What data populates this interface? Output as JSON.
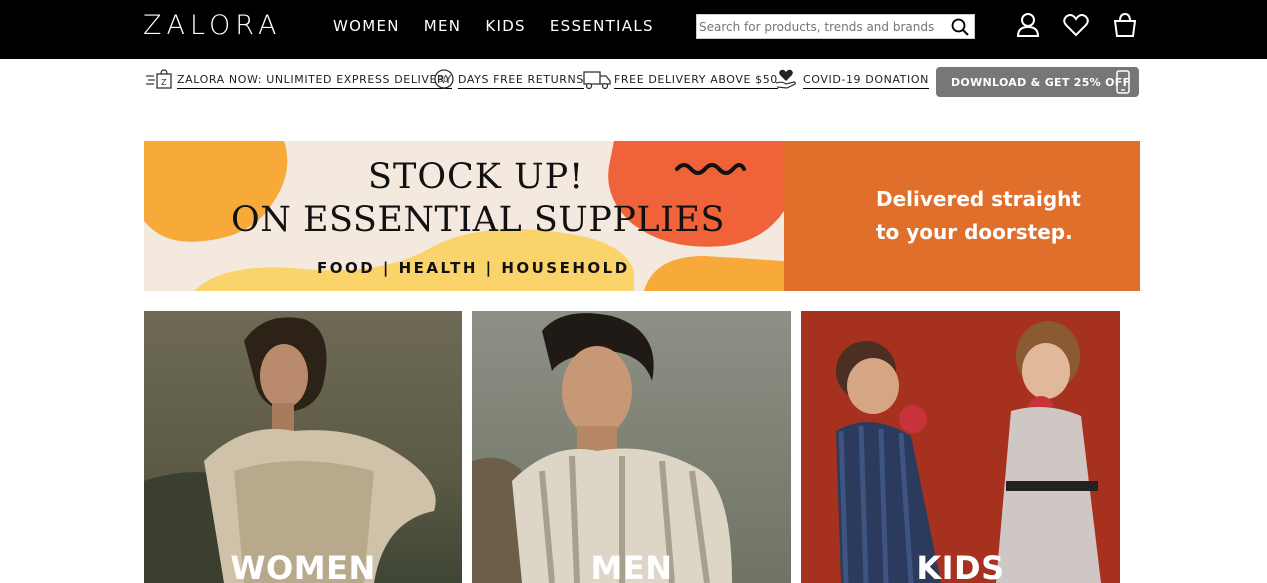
{
  "header": {
    "logo": "ZALORA",
    "nav": [
      "WOMEN",
      "MEN",
      "KIDS",
      "ESSENTIALS"
    ],
    "search_placeholder": "Search for products, trends and brands",
    "icons": [
      "user-icon",
      "heart-icon",
      "bag-icon"
    ]
  },
  "perks": [
    {
      "label": "ZALORA NOW: UNLIMITED EXPRESS DELIVERY",
      "icon": "express-icon"
    },
    {
      "label": "DAYS FREE RETURNS",
      "icon": "30-days-icon"
    },
    {
      "label": "FREE DELIVERY ABOVE $50",
      "icon": "truck-icon"
    },
    {
      "label": "COVID-19 DONATION",
      "icon": "donation-heart-icon"
    }
  ],
  "download_button": "DOWNLOAD & GET 25% OFF",
  "banner": {
    "line1": "STOCK UP!",
    "line2": "ON ESSENTIAL SUPPLIES",
    "sub": "FOOD | HEALTH | HOUSEHOLD",
    "right_line1": "Delivered straight",
    "right_line2": "to your doorstep.",
    "colors": {
      "cream": "#f4e9de",
      "orange": "#df6f2a",
      "yellow": "#f7a93a",
      "red": "#f0623a"
    }
  },
  "categories": [
    {
      "label": "WOMEN"
    },
    {
      "label": "MEN"
    },
    {
      "label": "KIDS"
    }
  ]
}
